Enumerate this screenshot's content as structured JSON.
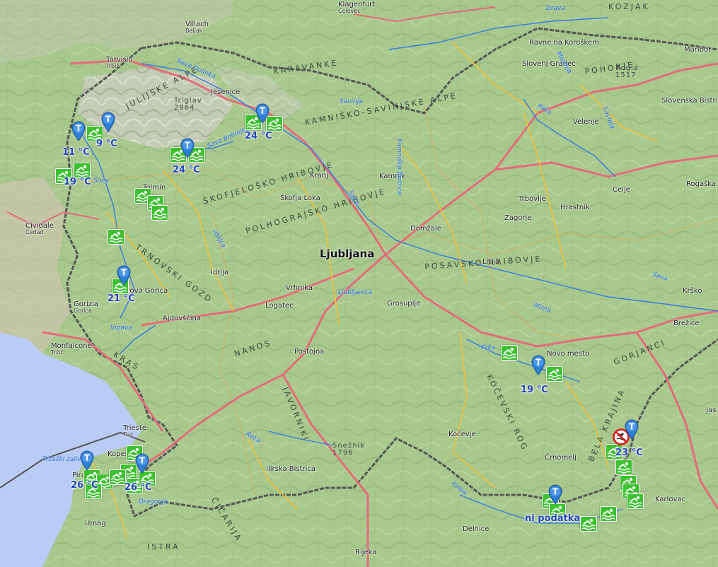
{
  "map": {
    "places": [
      {
        "name": "Klagenfurt",
        "sub": "Celovec"
      },
      {
        "name": "Villach",
        "sub": "Beljak"
      },
      {
        "name": "Tarvisio",
        "sub": "Trbiž"
      },
      {
        "name": "Jesenice"
      },
      {
        "name": "Ravne na Koroškem"
      },
      {
        "name": "Slovenj Gradec"
      },
      {
        "name": "Maribor"
      },
      {
        "name": "Velenje"
      },
      {
        "name": "Slovenska Bistrica"
      },
      {
        "name": "Kranj"
      },
      {
        "name": "Kamnik"
      },
      {
        "name": "Tolmin"
      },
      {
        "name": "Škofja Loka"
      },
      {
        "name": "Celje"
      },
      {
        "name": "Rogaška Slatina"
      },
      {
        "name": "Trbovlje"
      },
      {
        "name": "Hrastnik"
      },
      {
        "name": "Zagorje"
      },
      {
        "name": "Cividale",
        "sub": "Čedad"
      },
      {
        "name": "Domžale"
      },
      {
        "name": "Ljubljana",
        "big": true
      },
      {
        "name": "Litija"
      },
      {
        "name": "Idrija"
      },
      {
        "name": "Vrhnika"
      },
      {
        "name": "Nova Gorica"
      },
      {
        "name": "Gorizia",
        "sub": "Gorica"
      },
      {
        "name": "Logatec"
      },
      {
        "name": "Grosuplje"
      },
      {
        "name": "Krško"
      },
      {
        "name": "Ajdovščina"
      },
      {
        "name": "Brežice"
      },
      {
        "name": "Monfalcone",
        "sub": "Tržič"
      },
      {
        "name": "Novo mesto"
      },
      {
        "name": "Postojna"
      },
      {
        "name": "Trieste",
        "sub": "Trst"
      },
      {
        "name": "Kočevje"
      },
      {
        "name": "Koper"
      },
      {
        "name": "Ilirska Bistrica"
      },
      {
        "name": "Črnomelj"
      },
      {
        "name": "Piran"
      },
      {
        "name": "Karlovac"
      },
      {
        "name": "Umag"
      },
      {
        "name": "Delnice"
      },
      {
        "name": "Rijeka"
      },
      {
        "name": "Jas"
      }
    ],
    "regions": [
      "KARAVANKE",
      "KAMNIŠKO-SAVINJSKE ALPE",
      "POHORJE",
      "ŠKOFJELOŠKO HRIBOVJE",
      "POLHOGRAJSKO HRIBOVJE",
      "TRNOVSKI GOZD",
      "POSAVSKO HRIBOVJE",
      "KRAS",
      "NANOS",
      "JAVORNIKI",
      "KOČEVSKI ROG",
      "GORJANCI",
      "BELA KRAJINA",
      "ČIČARIJA",
      "ISTRA",
      "KOZJAK",
      "JULIJSKE ALPE"
    ],
    "peaks": [
      {
        "name": "Triglav",
        "elev": "2864"
      },
      {
        "name": "Rogla",
        "elev": "1517"
      },
      {
        "name": "Snežnik",
        "elev": "1796"
      }
    ],
    "waters": [
      "Sava Dolinka",
      "Drava",
      "Mislinja",
      "Paka",
      "Savinja",
      "Sava Bohinjka",
      "Soča",
      "Kamniška Bistrica",
      "Sava",
      "Idrijca",
      "Vipava",
      "Ljubljanica",
      "Sava",
      "Mirna",
      "Krka",
      "Kolpa",
      "Reka",
      "Dragonja",
      "Tržaški zaliv",
      "Savinja"
    ],
    "pins": [
      {
        "id": "bovec"
      },
      {
        "id": "kranjska"
      },
      {
        "id": "bled"
      },
      {
        "id": "kamnik"
      },
      {
        "id": "nova-gorica"
      },
      {
        "id": "koper"
      },
      {
        "id": "portoroz"
      },
      {
        "id": "novo-mesto"
      },
      {
        "id": "kolpa"
      },
      {
        "id": "metlika"
      }
    ],
    "temps": [
      "11 °C",
      "9 °C",
      "19 °C",
      "24 °C",
      "24 °C",
      "21 °C",
      "26 °C",
      "26 °C",
      "19 °C",
      "23 °C",
      "ni podatka"
    ],
    "colors": {
      "pin": "#2f7fd8",
      "swim": "#3cc12f",
      "temp_text": "#1f43b8",
      "road": "#e46c78",
      "border": "#555555",
      "sea": "#b9ccf5"
    }
  }
}
